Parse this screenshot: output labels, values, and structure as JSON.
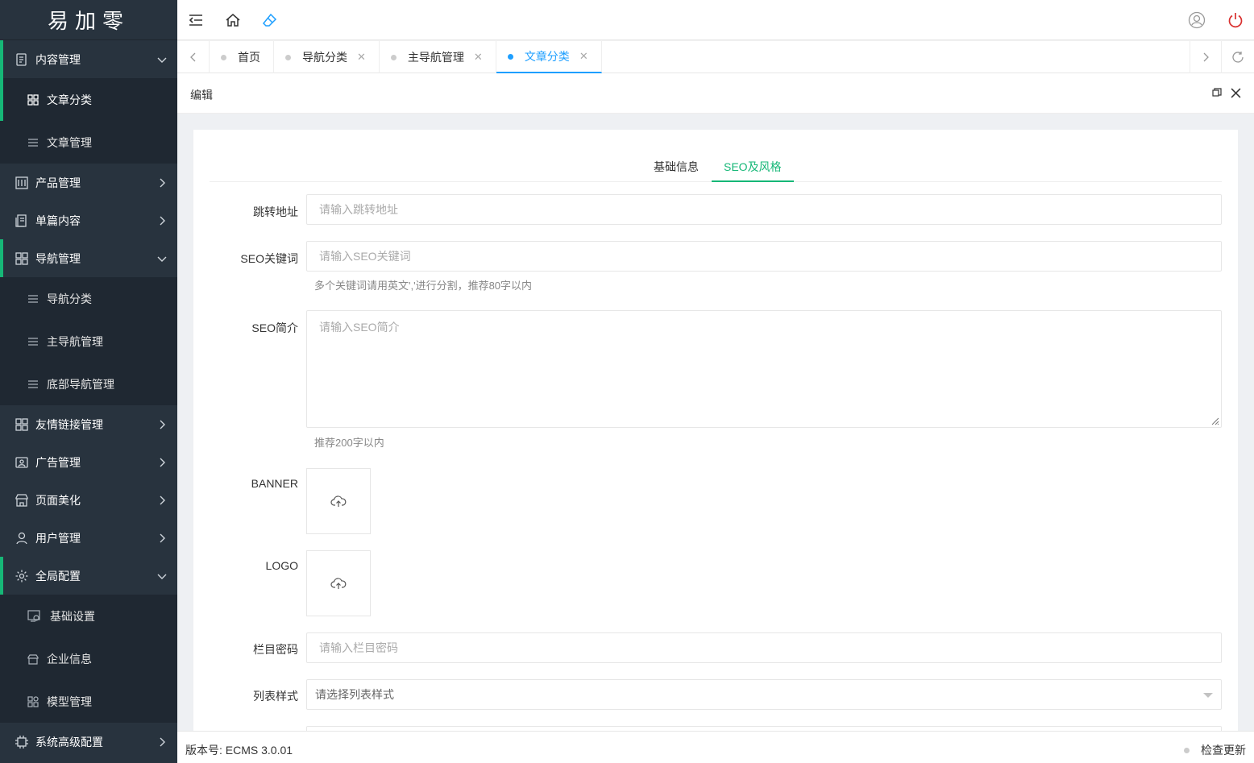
{
  "app": {
    "logo": "易加零"
  },
  "sidebar": {
    "items": [
      {
        "label": "内容管理",
        "icon": "content-icon",
        "expanded": true
      },
      {
        "label": "文章分类",
        "icon": "grid-icon",
        "active": true
      },
      {
        "label": "文章管理",
        "icon": "list-icon"
      },
      {
        "label": "产品管理",
        "icon": "product-icon"
      },
      {
        "label": "单篇内容",
        "icon": "page-icon"
      },
      {
        "label": "导航管理",
        "icon": "grid-icon",
        "expanded": true
      },
      {
        "label": "导航分类",
        "icon": "list-icon"
      },
      {
        "label": "主导航管理",
        "icon": "list-icon"
      },
      {
        "label": "底部导航管理",
        "icon": "list-icon"
      },
      {
        "label": "友情链接管理",
        "icon": "grid-icon"
      },
      {
        "label": "广告管理",
        "icon": "image-icon"
      },
      {
        "label": "页面美化",
        "icon": "store-icon"
      },
      {
        "label": "用户管理",
        "icon": "user-icon"
      },
      {
        "label": "全局配置",
        "icon": "gear-icon",
        "expanded": true
      },
      {
        "label": "基础设置",
        "icon": "settings-screen-icon"
      },
      {
        "label": "企业信息",
        "icon": "store-icon"
      },
      {
        "label": "模型管理",
        "icon": "blocks-icon"
      },
      {
        "label": "系统高级配置",
        "icon": "chip-icon"
      }
    ]
  },
  "tabs": [
    {
      "label": "首页"
    },
    {
      "label": "导航分类"
    },
    {
      "label": "主导航管理"
    },
    {
      "label": "文章分类",
      "active": true
    }
  ],
  "panel": {
    "title": "编辑"
  },
  "form": {
    "tabs": [
      "基础信息",
      "SEO及风格"
    ],
    "active_tab": "SEO及风格",
    "jump_url": {
      "label": "跳转地址",
      "placeholder": "请输入跳转地址"
    },
    "seo_keywords": {
      "label": "SEO关键词",
      "placeholder": "请输入SEO关键词",
      "hint": "多个关键词请用英文','进行分割，推荐80字以内"
    },
    "seo_desc": {
      "label": "SEO简介",
      "placeholder": "请输入SEO简介",
      "hint": "推荐200字以内"
    },
    "banner": {
      "label": "BANNER"
    },
    "logo": {
      "label": "LOGO"
    },
    "password": {
      "label": "栏目密码",
      "placeholder": "请输入栏目密码"
    },
    "list_style": {
      "label": "列表样式",
      "placeholder": "请选择列表样式"
    }
  },
  "footer": {
    "version": "版本号: ECMS 3.0.01",
    "update": "检查更新"
  },
  "colors": {
    "accent": "#16b777",
    "tab_active": "#1e9fff",
    "sidebar_bg": "#28333e"
  }
}
